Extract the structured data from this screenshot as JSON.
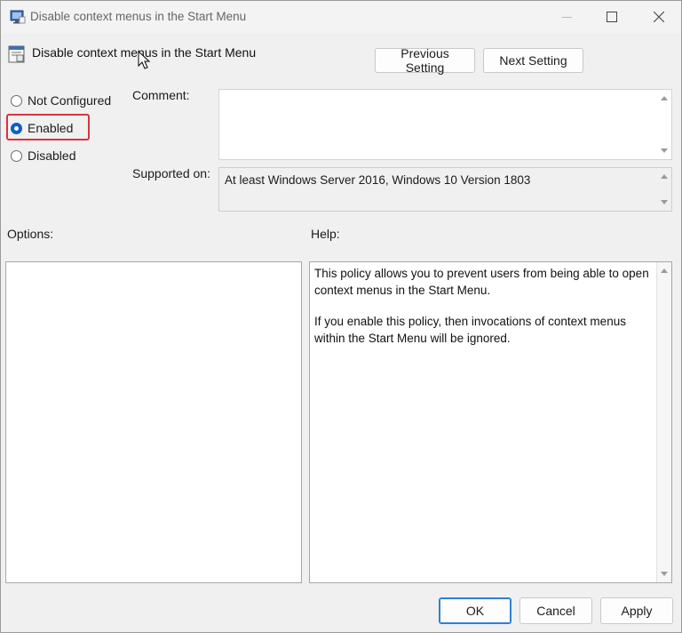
{
  "window": {
    "title": "Disable context menus in the Start Menu"
  },
  "header": {
    "policy_name": "Disable context menus in the Start Menu",
    "previous_label": "Previous Setting",
    "next_label": "Next Setting"
  },
  "state": {
    "options": [
      "Not Configured",
      "Enabled",
      "Disabled"
    ],
    "selected": "Enabled"
  },
  "comment": {
    "label": "Comment:",
    "value": ""
  },
  "supported": {
    "label": "Supported on:",
    "value": "At least Windows Server 2016, Windows 10 Version 1803"
  },
  "panels": {
    "options_label": "Options:",
    "help_label": "Help:",
    "help_paragraphs": [
      "This policy allows you to prevent users from being able to open context menus in the Start Menu.",
      "If you enable this policy, then invocations of context menus within the Start Menu will be ignored."
    ]
  },
  "footer": {
    "ok_label": "OK",
    "cancel_label": "Cancel",
    "apply_label": "Apply"
  },
  "colors": {
    "highlight": "#d9343e",
    "accent": "#0a5fcf"
  },
  "icons": {
    "title": "policy-app-icon",
    "policy": "policy-setting-icon",
    "minimize": "minimize-icon",
    "maximize": "maximize-icon",
    "close": "close-icon"
  }
}
